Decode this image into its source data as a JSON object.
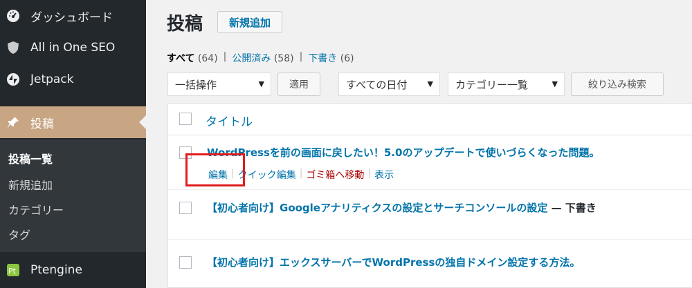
{
  "sidebar": {
    "items": [
      {
        "label": "ダッシュボード",
        "icon": "dashboard-icon"
      },
      {
        "label": "All in One SEO",
        "icon": "shield-icon"
      },
      {
        "label": "Jetpack",
        "icon": "jetpack-icon"
      },
      {
        "label": "投稿",
        "icon": "pin-icon",
        "current": true
      },
      {
        "label": "Ptengine",
        "icon": "ptengine-icon"
      }
    ],
    "submenu": [
      "投稿一覧",
      "新規追加",
      "カテゴリー",
      "タグ"
    ]
  },
  "header": {
    "title": "投稿",
    "add_new_label": "新規追加"
  },
  "filters": {
    "views": [
      {
        "label": "すべて",
        "count": "(64)",
        "current": true
      },
      {
        "label": "公開済み",
        "count": "(58)"
      },
      {
        "label": "下書き",
        "count": "(6)"
      }
    ],
    "bulk_action": "一括操作",
    "apply_label": "適用",
    "date_filter": "すべての日付",
    "category_filter": "カテゴリー一覧",
    "filter_label": "絞り込み検索"
  },
  "table": {
    "header_title": "タイトル",
    "rows": [
      {
        "title": "WordPressを前の画面に戻したい！5.0のアップデートで使いづらくなった問題。",
        "state": ""
      },
      {
        "title": "【初心者向け】Googleアナリティクスの設定とサーチコンソールの設定",
        "state": "— 下書き"
      },
      {
        "title": "【初心者向け】エックスサーバーでWordPressの独自ドメイン設定する方法。",
        "state": ""
      }
    ],
    "row_actions": [
      "編集",
      "クイック編集",
      "ゴミ箱へ移動",
      "表示"
    ]
  },
  "colors": {
    "sidebar_bg": "#23282d",
    "submenu_bg": "#32373c",
    "current_menu": "#c8a583",
    "link": "#0073aa",
    "trash": "#a00000",
    "highlight": "#e21b1b"
  }
}
